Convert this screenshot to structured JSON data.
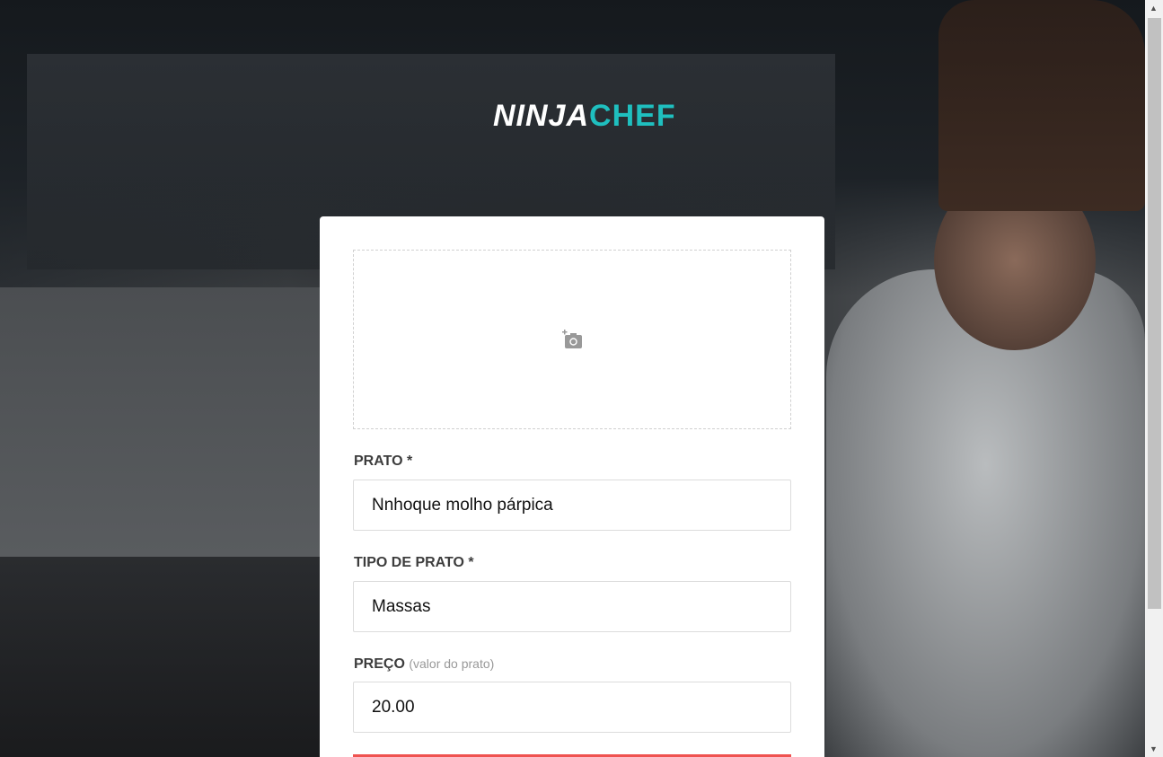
{
  "logo": {
    "part1": "NINJA",
    "part2": "CHEF"
  },
  "upload": {
    "icon": "add-photo-icon"
  },
  "fields": {
    "prato": {
      "label": "PRATO *",
      "value": "Nnhoque molho párpica"
    },
    "tipo": {
      "label": "TIPO DE PRATO *",
      "value": "Massas"
    },
    "preco": {
      "label": "PREÇO",
      "hint": "(valor do prato)",
      "value": "20.00"
    }
  },
  "colors": {
    "accent": "#1fbfbf",
    "button": "#ef5350"
  }
}
